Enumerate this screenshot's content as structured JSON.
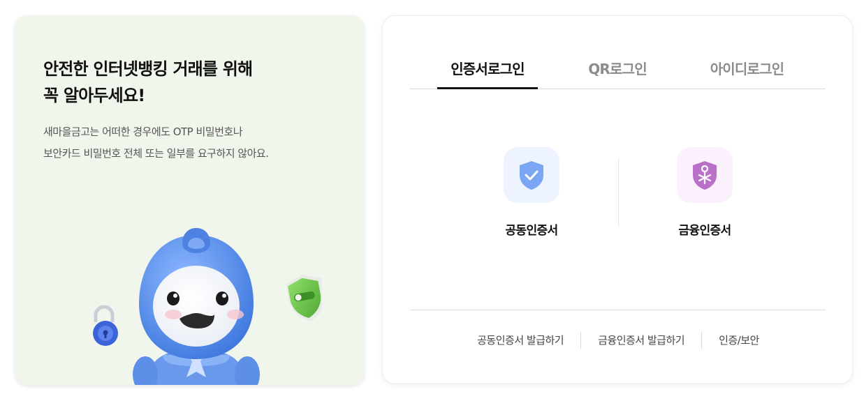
{
  "notice": {
    "title_line1": "안전한 인터넷뱅킹 거래를 위해",
    "title_line2": "꼭 알아두세요!",
    "desc_line1": "새마을금고는 어떠한 경우에도 OTP 비밀번호나",
    "desc_line2": "보안카드 비밀번호 전체 또는 일부를 요구하지 않아요."
  },
  "login": {
    "tabs": [
      {
        "label": "인증서로그인",
        "active": true
      },
      {
        "label": "QR로그인",
        "active": false
      },
      {
        "label": "아이디로그인",
        "active": false
      }
    ],
    "options": [
      {
        "label": "공동인증서",
        "icon": "shield-check-icon",
        "color": "#7aa6f5"
      },
      {
        "label": "금융인증서",
        "icon": "shield-key-icon",
        "color": "#b870c9"
      }
    ],
    "bottom_links": [
      "공동인증서 발급하기",
      "금융인증서 발급하기",
      "인증/보안"
    ]
  },
  "colors": {
    "left_card_bg": "#f1f6ec",
    "mascot_blue": "#5b8fe6",
    "shield_green": "#6cc24a",
    "lock_blue": "#3d63d8"
  }
}
